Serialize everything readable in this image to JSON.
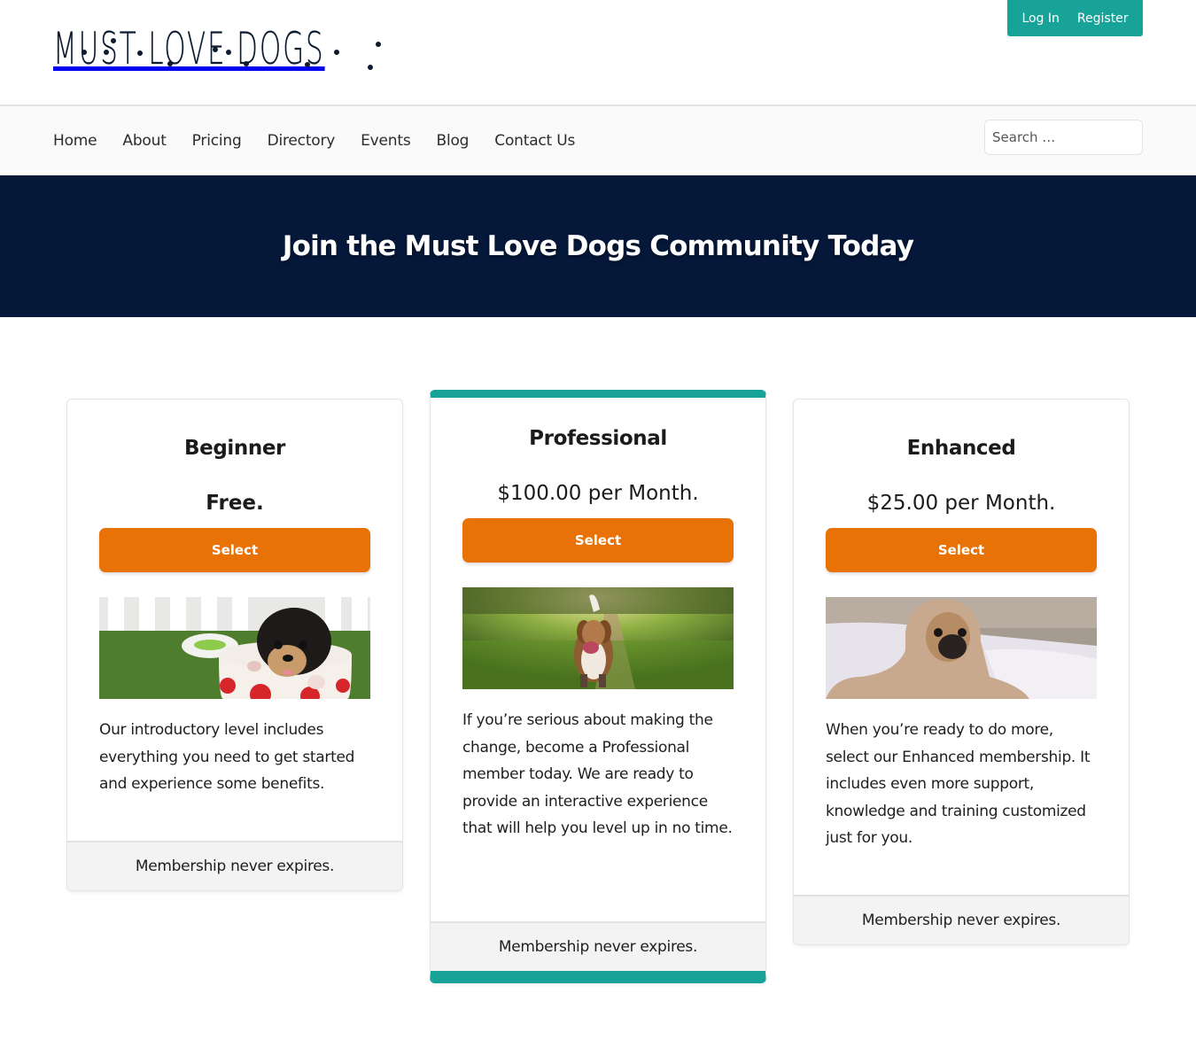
{
  "site": {
    "logo_text": "MUST LOVE DOGS"
  },
  "account": {
    "login_label": "Log In",
    "register_label": "Register",
    "accent_color": "#17a398"
  },
  "nav": {
    "items": [
      {
        "label": "Home"
      },
      {
        "label": "About"
      },
      {
        "label": "Pricing"
      },
      {
        "label": "Directory"
      },
      {
        "label": "Events"
      },
      {
        "label": "Blog"
      },
      {
        "label": "Contact Us"
      }
    ],
    "search_placeholder": "Search …"
  },
  "hero": {
    "title": "Join the Must Love Dogs Community Today",
    "background_color": "#05183a"
  },
  "plans": [
    {
      "name": "Beginner",
      "price": "Free.",
      "button_label": "Select",
      "image_alt": "Puppy in a polka-dot cup on grass",
      "description": "Our introductory level includes everything you need to get started and experience some benefits.",
      "footer": "Membership never expires.",
      "featured": false
    },
    {
      "name": "Professional",
      "price": "$100.00 per Month.",
      "button_label": "Select",
      "image_alt": "Beagle running on a grassy path",
      "description": "If you’re serious about making the change, become a Professional member today. We are ready to provide an interactive experience that will help you level up in no time.",
      "footer": "Membership never expires.",
      "featured": true
    },
    {
      "name": "Enhanced",
      "price": "$25.00 per Month.",
      "button_label": "Select",
      "image_alt": "Pug wrapped in a blanket on a bed",
      "description": "When you’re ready to do more, select our Enhanced membership. It includes even more support, knowledge and training customized just for you.",
      "footer": "Membership never expires.",
      "featured": false
    }
  ],
  "colors": {
    "button": "#e87206",
    "featured_border": "#17a398"
  }
}
